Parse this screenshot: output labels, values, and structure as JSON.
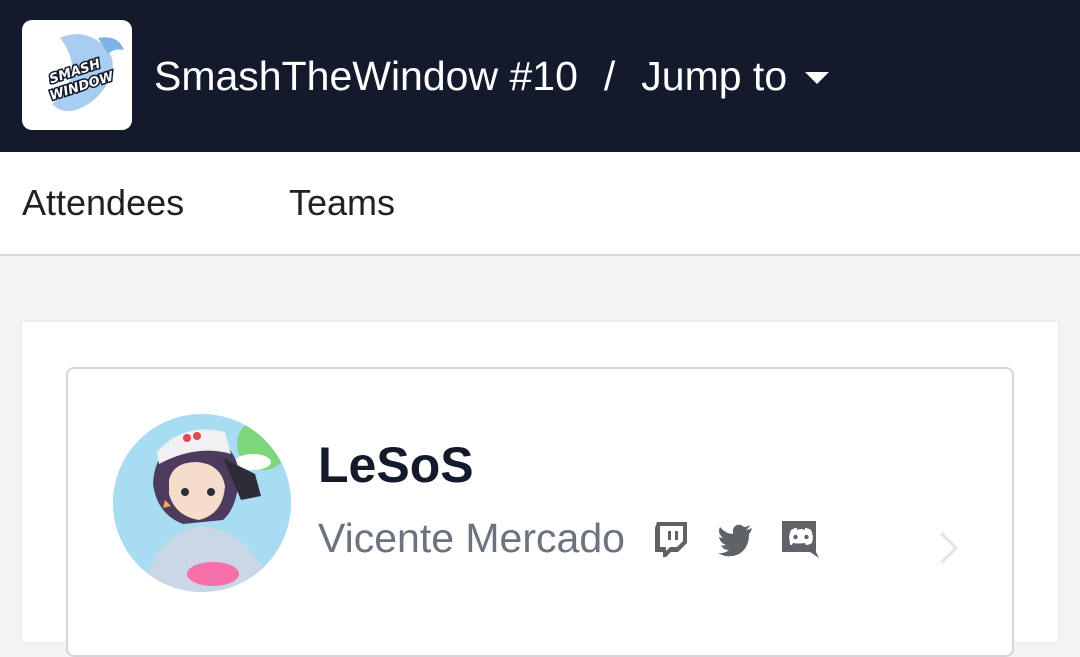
{
  "header": {
    "event_title": "SmashTheWindow #10",
    "separator": "/",
    "jump_label": "Jump to",
    "logo_text_top": "SMASH THE",
    "logo_text_bottom": "WINDOW"
  },
  "tabs": [
    {
      "label": "Attendees"
    },
    {
      "label": "Teams"
    }
  ],
  "player": {
    "gamer_tag": "LeSoS",
    "real_name": "Vicente Mercado",
    "socials": [
      "twitch-icon",
      "twitter-icon",
      "discord-icon"
    ]
  },
  "colors": {
    "header_bg": "#131a2b",
    "text_dark": "#131a2b",
    "text_muted": "#6b7280",
    "icon_gray": "#5f6368"
  }
}
